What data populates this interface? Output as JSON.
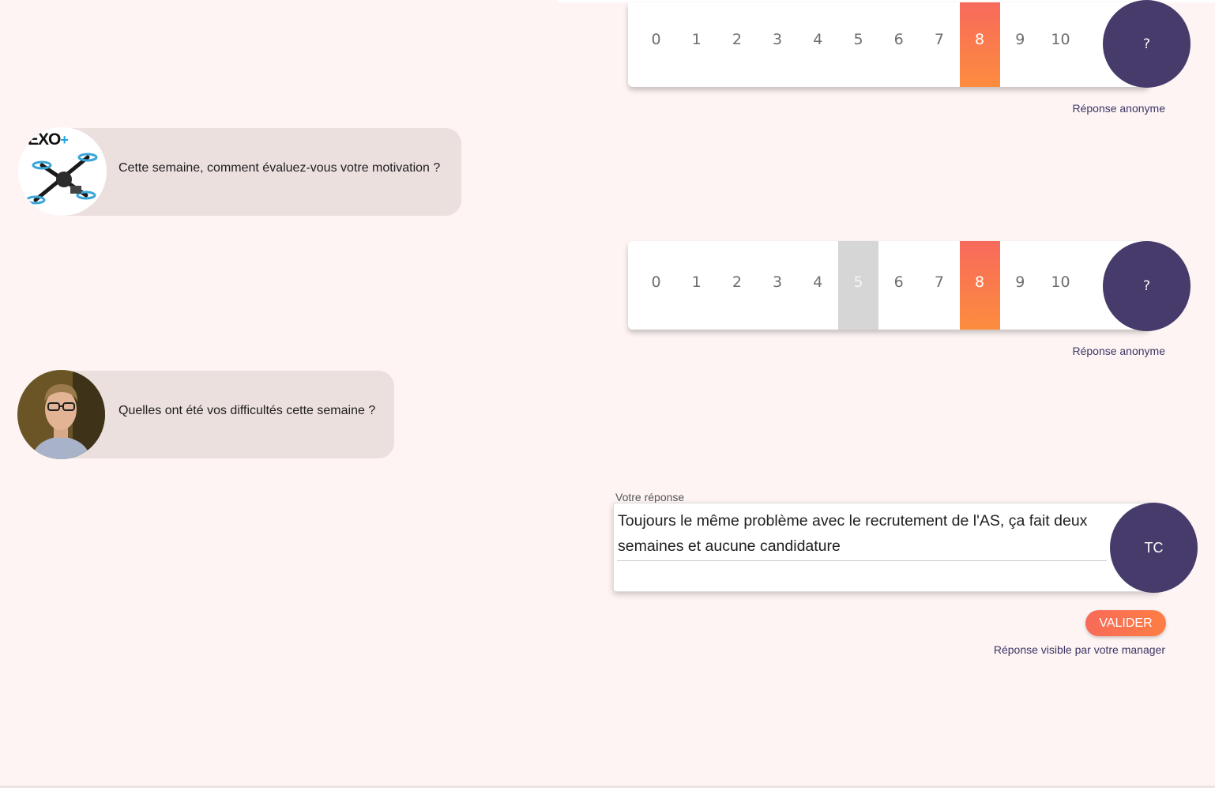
{
  "colors": {
    "background": "#fdf4f3",
    "accent_gradient_start": "#f76a5c",
    "accent_gradient_end": "#fd8c3e",
    "circle": "#463b6a",
    "bubble": "#ece0df",
    "previous_score": "#d6d6d6"
  },
  "rating_1": {
    "scale": [
      "0",
      "1",
      "2",
      "3",
      "4",
      "5",
      "6",
      "7",
      "8",
      "9",
      "10"
    ],
    "selected": "8",
    "help_label": "?",
    "note": "Réponse anonyme"
  },
  "question_1": {
    "text": "Cette semaine, comment évaluez-vous votre motivation ?",
    "avatar_logo": "EXO",
    "avatar_logo_plus": "+"
  },
  "rating_2": {
    "scale": [
      "0",
      "1",
      "2",
      "3",
      "4",
      "5",
      "6",
      "7",
      "8",
      "9",
      "10"
    ],
    "selected": "8",
    "previous": "5",
    "help_label": "?",
    "note": "Réponse anonyme"
  },
  "question_2": {
    "text": "Quelles ont été vos difficultés cette semaine ?"
  },
  "answer": {
    "label": "Votre réponse",
    "value": "Toujours le même problème avec le recrutement de l'AS, ça fait deux semaines et aucune candidature",
    "user_initials": "TC",
    "submit_label": "VALIDER",
    "visibility_note": "Réponse visible par votre manager"
  }
}
